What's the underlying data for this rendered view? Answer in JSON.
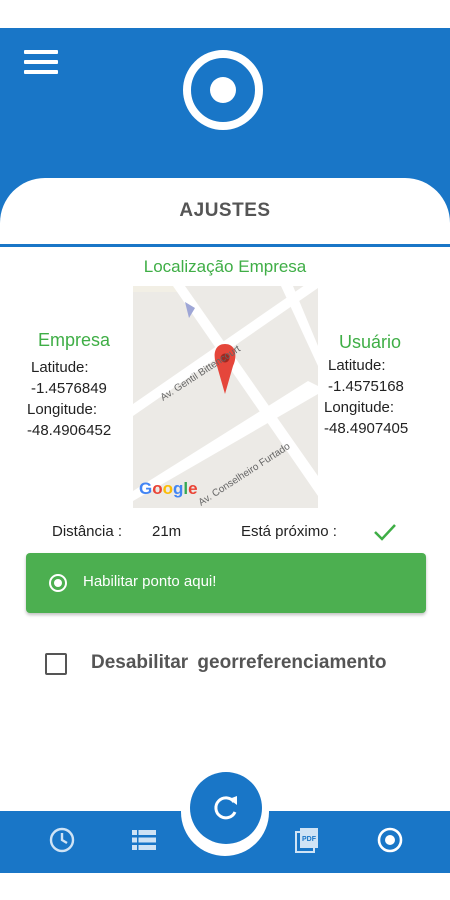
{
  "header": {
    "title": "AJUSTES",
    "accent_color": "#1976c7",
    "icons": {
      "menu": "hamburger-menu-icon",
      "logo": "target-logo-icon"
    }
  },
  "location": {
    "section_title": "Localização Empresa",
    "empresa": {
      "title": "Empresa",
      "latitude_label": "Latitude:",
      "latitude_value": "-1.4576849",
      "longitude_label": "Longitude:",
      "longitude_value": "-48.4906452"
    },
    "usuario": {
      "title": "Usuário",
      "latitude_label": "Latitude:",
      "latitude_value": "-1.4575168",
      "longitude_label": "Longitude:",
      "longitude_value": "-48.4907405"
    },
    "map": {
      "street_1": "Av. Gentil Bittencourt",
      "street_2": "Av. Conselheiro Furtado",
      "provider": "Google"
    }
  },
  "distance": {
    "label": "Distância :",
    "value": "21m",
    "near_label": "Está próximo :",
    "near_icon": "checkmark-icon",
    "near_color": "#3fae46"
  },
  "enable_button": {
    "label": "Habilitar ponto aqui!",
    "color": "#4caf50"
  },
  "disable_georef": {
    "label": "Desabilitar  georreferenciamento",
    "checked": false
  },
  "bottom_nav": {
    "fab_icon": "refresh-icon",
    "items": [
      "history-clock-icon",
      "list-icon",
      "pdf-icon",
      "target-icon"
    ]
  }
}
